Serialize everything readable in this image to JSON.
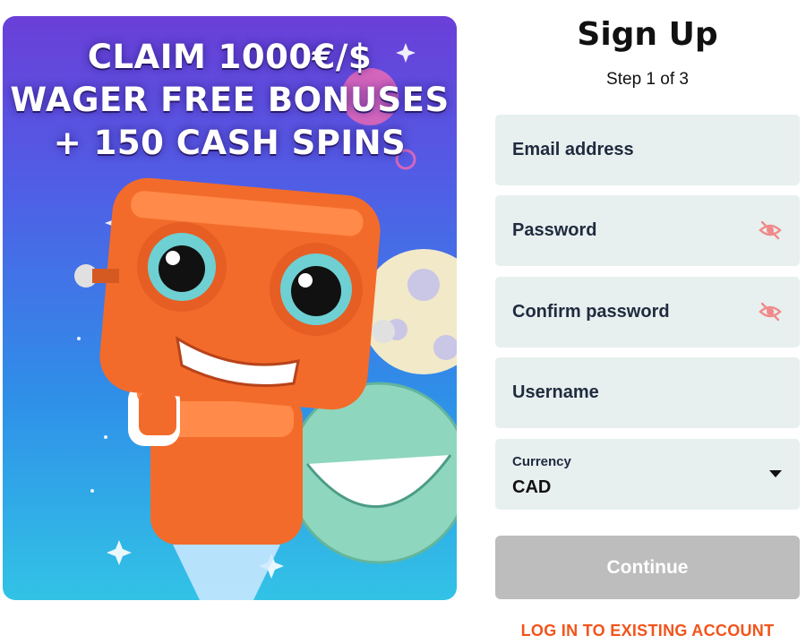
{
  "promo": {
    "headline_lines": [
      "CLAIM  1000€/$",
      "WAGER FREE BONUSES",
      "+ 150 CASH SPINS"
    ]
  },
  "form": {
    "title": "Sign Up",
    "step": "Step 1 of 3",
    "email_placeholder": "Email address",
    "password_placeholder": "Password",
    "confirm_password_placeholder": "Confirm password",
    "username_placeholder": "Username",
    "currency_label": "Currency",
    "currency_value": "CAD",
    "continue_label": "Continue",
    "login_link": "LOG IN TO EXISTING ACCOUNT"
  },
  "colors": {
    "accent": "#f2541b",
    "field_bg": "#e8efef",
    "button_disabled": "#bdbdbd",
    "eye_icon": "#f08a8a"
  },
  "icons": [
    "eye-slash-icon",
    "chevron-down-icon"
  ]
}
